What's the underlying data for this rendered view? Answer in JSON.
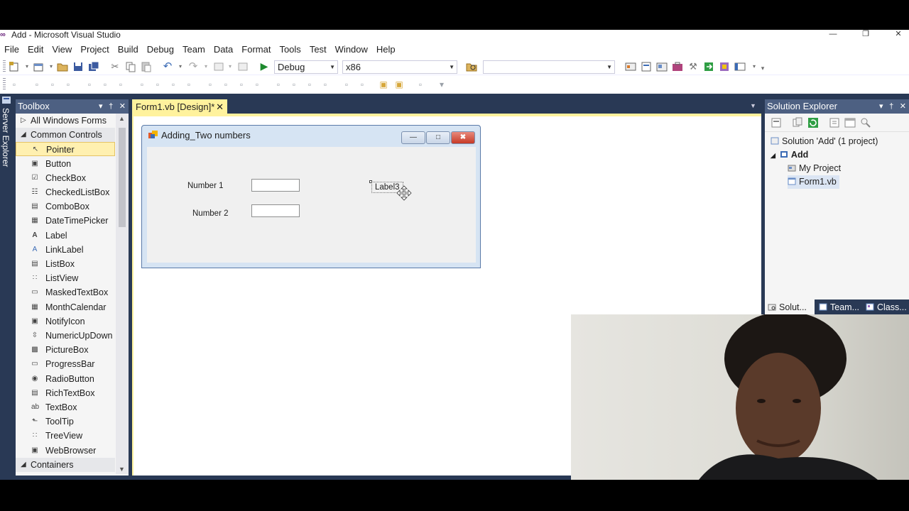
{
  "window": {
    "title": "Add - Microsoft Visual Studio",
    "controls": {
      "minimize": "—",
      "restore": "❐",
      "close": "✕"
    }
  },
  "menu": [
    "File",
    "Edit",
    "View",
    "Project",
    "Build",
    "Debug",
    "Team",
    "Data",
    "Format",
    "Tools",
    "Test",
    "Window",
    "Help"
  ],
  "toolbar": {
    "configuration": "Debug",
    "platform": "x86",
    "find_value": ""
  },
  "side_strip": {
    "label": "Server Explorer"
  },
  "toolbox": {
    "title": "Toolbox",
    "header_buttons": "▾  †  ✕",
    "items": [
      {
        "label": "All Windows Forms",
        "kind": "category",
        "expanded": false,
        "icon": "chevron-right-icon"
      },
      {
        "label": "Common Controls",
        "kind": "category",
        "expanded": true,
        "icon": "chevron-down-icon"
      },
      {
        "label": "Pointer",
        "kind": "item",
        "icon": "pointer-icon",
        "glyph": "↖",
        "selected": true
      },
      {
        "label": "Button",
        "kind": "item",
        "icon": "button-icon",
        "glyph": "▣"
      },
      {
        "label": "CheckBox",
        "kind": "item",
        "icon": "checkbox-icon",
        "glyph": "☑"
      },
      {
        "label": "CheckedListBox",
        "kind": "item",
        "icon": "checkedlistbox-icon",
        "glyph": "☷"
      },
      {
        "label": "ComboBox",
        "kind": "item",
        "icon": "combobox-icon",
        "glyph": "▤"
      },
      {
        "label": "DateTimePicker",
        "kind": "item",
        "icon": "datetimepicker-icon",
        "glyph": "▦"
      },
      {
        "label": "Label",
        "kind": "item",
        "icon": "label-icon",
        "glyph": "A"
      },
      {
        "label": "LinkLabel",
        "kind": "item",
        "icon": "linklabel-icon",
        "glyph": "A"
      },
      {
        "label": "ListBox",
        "kind": "item",
        "icon": "listbox-icon",
        "glyph": "▤"
      },
      {
        "label": "ListView",
        "kind": "item",
        "icon": "listview-icon",
        "glyph": "∷"
      },
      {
        "label": "MaskedTextBox",
        "kind": "item",
        "icon": "maskedtextbox-icon",
        "glyph": "▭"
      },
      {
        "label": "MonthCalendar",
        "kind": "item",
        "icon": "monthcalendar-icon",
        "glyph": "▦"
      },
      {
        "label": "NotifyIcon",
        "kind": "item",
        "icon": "notifyicon-icon",
        "glyph": "▣"
      },
      {
        "label": "NumericUpDown",
        "kind": "item",
        "icon": "numericupdown-icon",
        "glyph": "⇳"
      },
      {
        "label": "PictureBox",
        "kind": "item",
        "icon": "picturebox-icon",
        "glyph": "▩"
      },
      {
        "label": "ProgressBar",
        "kind": "item",
        "icon": "progressbar-icon",
        "glyph": "▭"
      },
      {
        "label": "RadioButton",
        "kind": "item",
        "icon": "radiobutton-icon",
        "glyph": "◉"
      },
      {
        "label": "RichTextBox",
        "kind": "item",
        "icon": "richtextbox-icon",
        "glyph": "▤"
      },
      {
        "label": "TextBox",
        "kind": "item",
        "icon": "textbox-icon",
        "glyph": "ab"
      },
      {
        "label": "ToolTip",
        "kind": "item",
        "icon": "tooltip-icon",
        "glyph": "⬑"
      },
      {
        "label": "TreeView",
        "kind": "item",
        "icon": "treeview-icon",
        "glyph": "∷"
      },
      {
        "label": "WebBrowser",
        "kind": "item",
        "icon": "webbrowser-icon",
        "glyph": "▣"
      },
      {
        "label": "Containers",
        "kind": "category",
        "expanded": true,
        "icon": "chevron-down-icon"
      }
    ]
  },
  "document_tab": {
    "label": "Form1.vb [Design]*",
    "close": "✕"
  },
  "form": {
    "title": "Adding_Two numbers",
    "minimize": "—",
    "maximize": "□",
    "close": "✖",
    "label_number1": "Number 1",
    "label_number2": "Number 2",
    "textbox1_value": "",
    "textbox2_value": "",
    "label3": "Label3"
  },
  "solution_explorer": {
    "title": "Solution Explorer",
    "header_buttons": "▾  †  ✕",
    "solution": "Solution 'Add' (1 project)",
    "project": "Add",
    "items": [
      "My Project",
      "Form1.vb"
    ],
    "tabs": [
      "Solut...",
      "Team...",
      "Class..."
    ]
  },
  "colors": {
    "vs_chrome": "#293955",
    "panel_header": "#4d6082",
    "active_tab": "#fff29d",
    "selection": "#fff0b0"
  }
}
